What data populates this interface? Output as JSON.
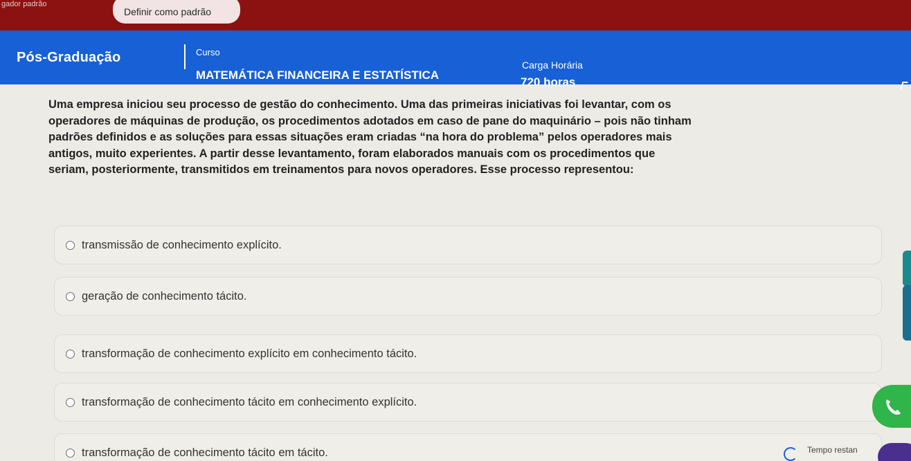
{
  "topbar": {
    "default_text": "gador padrão",
    "set_default_label": "Definir como padrão"
  },
  "header": {
    "program": "Pós-Graduação",
    "course_label": "Curso",
    "course_name": "MATEMÁTICA FINANCEIRA E ESTATÍSTICA",
    "hours_label": "Carga Horária",
    "hours_value": "720 horas"
  },
  "question": {
    "lines": [
      "Uma empresa iniciou seu processo de gestão do conhecimento. Uma das primeiras iniciativas foi levantar, com os",
      "operadores de máquinas de produção, os procedimentos adotados em caso de pane do maquinário – pois não tinham",
      "padrões definidos e as soluções para essas situações eram criadas “na hora do problema” pelos operadores mais",
      "antigos, muito experientes. A partir desse levantamento, foram elaborados manuais com os procedimentos que",
      "seriam, posteriormente, transmitidos em treinamentos para novos operadores. Esse processo representou:"
    ]
  },
  "options": [
    {
      "label": "transmissão de conhecimento explícito."
    },
    {
      "label": "geração de conhecimento tácito."
    },
    {
      "label": "transformação de conhecimento explícito em conhecimento tácito."
    },
    {
      "label": "transformação de conhecimento tácito em conhecimento explícito."
    },
    {
      "label": "transformação de conhecimento tácito em tácito."
    }
  ],
  "footer": {
    "timer_label": "Tempo restan"
  },
  "colors": {
    "topbar": "#8c1212",
    "header": "#1760d6",
    "chat": "#2fb54a"
  },
  "icons": {
    "chat": "whatsapp-icon",
    "timer": "timer-icon"
  }
}
